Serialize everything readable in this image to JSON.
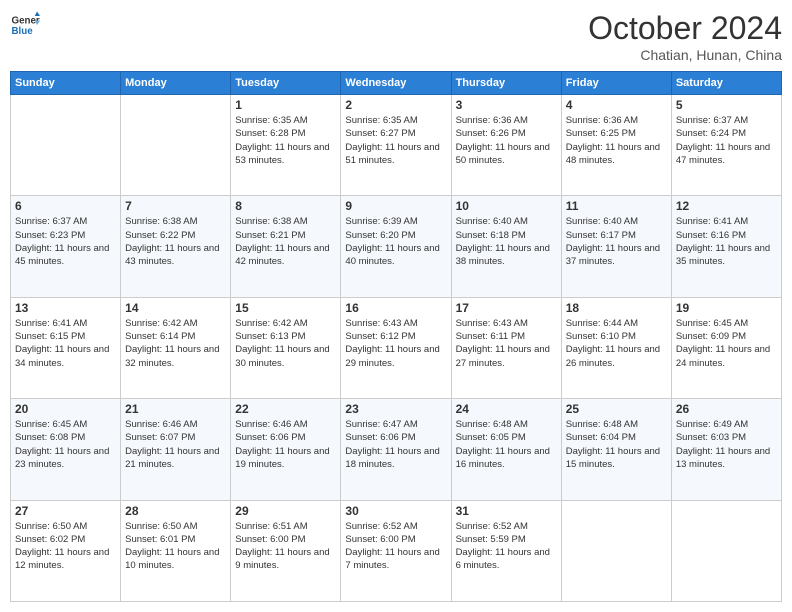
{
  "header": {
    "logo_line1": "General",
    "logo_line2": "Blue",
    "month": "October 2024",
    "location": "Chatian, Hunan, China"
  },
  "days_of_week": [
    "Sunday",
    "Monday",
    "Tuesday",
    "Wednesday",
    "Thursday",
    "Friday",
    "Saturday"
  ],
  "weeks": [
    [
      {
        "day": "",
        "info": ""
      },
      {
        "day": "",
        "info": ""
      },
      {
        "day": "1",
        "info": "Sunrise: 6:35 AM\nSunset: 6:28 PM\nDaylight: 11 hours and 53 minutes."
      },
      {
        "day": "2",
        "info": "Sunrise: 6:35 AM\nSunset: 6:27 PM\nDaylight: 11 hours and 51 minutes."
      },
      {
        "day": "3",
        "info": "Sunrise: 6:36 AM\nSunset: 6:26 PM\nDaylight: 11 hours and 50 minutes."
      },
      {
        "day": "4",
        "info": "Sunrise: 6:36 AM\nSunset: 6:25 PM\nDaylight: 11 hours and 48 minutes."
      },
      {
        "day": "5",
        "info": "Sunrise: 6:37 AM\nSunset: 6:24 PM\nDaylight: 11 hours and 47 minutes."
      }
    ],
    [
      {
        "day": "6",
        "info": "Sunrise: 6:37 AM\nSunset: 6:23 PM\nDaylight: 11 hours and 45 minutes."
      },
      {
        "day": "7",
        "info": "Sunrise: 6:38 AM\nSunset: 6:22 PM\nDaylight: 11 hours and 43 minutes."
      },
      {
        "day": "8",
        "info": "Sunrise: 6:38 AM\nSunset: 6:21 PM\nDaylight: 11 hours and 42 minutes."
      },
      {
        "day": "9",
        "info": "Sunrise: 6:39 AM\nSunset: 6:20 PM\nDaylight: 11 hours and 40 minutes."
      },
      {
        "day": "10",
        "info": "Sunrise: 6:40 AM\nSunset: 6:18 PM\nDaylight: 11 hours and 38 minutes."
      },
      {
        "day": "11",
        "info": "Sunrise: 6:40 AM\nSunset: 6:17 PM\nDaylight: 11 hours and 37 minutes."
      },
      {
        "day": "12",
        "info": "Sunrise: 6:41 AM\nSunset: 6:16 PM\nDaylight: 11 hours and 35 minutes."
      }
    ],
    [
      {
        "day": "13",
        "info": "Sunrise: 6:41 AM\nSunset: 6:15 PM\nDaylight: 11 hours and 34 minutes."
      },
      {
        "day": "14",
        "info": "Sunrise: 6:42 AM\nSunset: 6:14 PM\nDaylight: 11 hours and 32 minutes."
      },
      {
        "day": "15",
        "info": "Sunrise: 6:42 AM\nSunset: 6:13 PM\nDaylight: 11 hours and 30 minutes."
      },
      {
        "day": "16",
        "info": "Sunrise: 6:43 AM\nSunset: 6:12 PM\nDaylight: 11 hours and 29 minutes."
      },
      {
        "day": "17",
        "info": "Sunrise: 6:43 AM\nSunset: 6:11 PM\nDaylight: 11 hours and 27 minutes."
      },
      {
        "day": "18",
        "info": "Sunrise: 6:44 AM\nSunset: 6:10 PM\nDaylight: 11 hours and 26 minutes."
      },
      {
        "day": "19",
        "info": "Sunrise: 6:45 AM\nSunset: 6:09 PM\nDaylight: 11 hours and 24 minutes."
      }
    ],
    [
      {
        "day": "20",
        "info": "Sunrise: 6:45 AM\nSunset: 6:08 PM\nDaylight: 11 hours and 23 minutes."
      },
      {
        "day": "21",
        "info": "Sunrise: 6:46 AM\nSunset: 6:07 PM\nDaylight: 11 hours and 21 minutes."
      },
      {
        "day": "22",
        "info": "Sunrise: 6:46 AM\nSunset: 6:06 PM\nDaylight: 11 hours and 19 minutes."
      },
      {
        "day": "23",
        "info": "Sunrise: 6:47 AM\nSunset: 6:06 PM\nDaylight: 11 hours and 18 minutes."
      },
      {
        "day": "24",
        "info": "Sunrise: 6:48 AM\nSunset: 6:05 PM\nDaylight: 11 hours and 16 minutes."
      },
      {
        "day": "25",
        "info": "Sunrise: 6:48 AM\nSunset: 6:04 PM\nDaylight: 11 hours and 15 minutes."
      },
      {
        "day": "26",
        "info": "Sunrise: 6:49 AM\nSunset: 6:03 PM\nDaylight: 11 hours and 13 minutes."
      }
    ],
    [
      {
        "day": "27",
        "info": "Sunrise: 6:50 AM\nSunset: 6:02 PM\nDaylight: 11 hours and 12 minutes."
      },
      {
        "day": "28",
        "info": "Sunrise: 6:50 AM\nSunset: 6:01 PM\nDaylight: 11 hours and 10 minutes."
      },
      {
        "day": "29",
        "info": "Sunrise: 6:51 AM\nSunset: 6:00 PM\nDaylight: 11 hours and 9 minutes."
      },
      {
        "day": "30",
        "info": "Sunrise: 6:52 AM\nSunset: 6:00 PM\nDaylight: 11 hours and 7 minutes."
      },
      {
        "day": "31",
        "info": "Sunrise: 6:52 AM\nSunset: 5:59 PM\nDaylight: 11 hours and 6 minutes."
      },
      {
        "day": "",
        "info": ""
      },
      {
        "day": "",
        "info": ""
      }
    ]
  ]
}
